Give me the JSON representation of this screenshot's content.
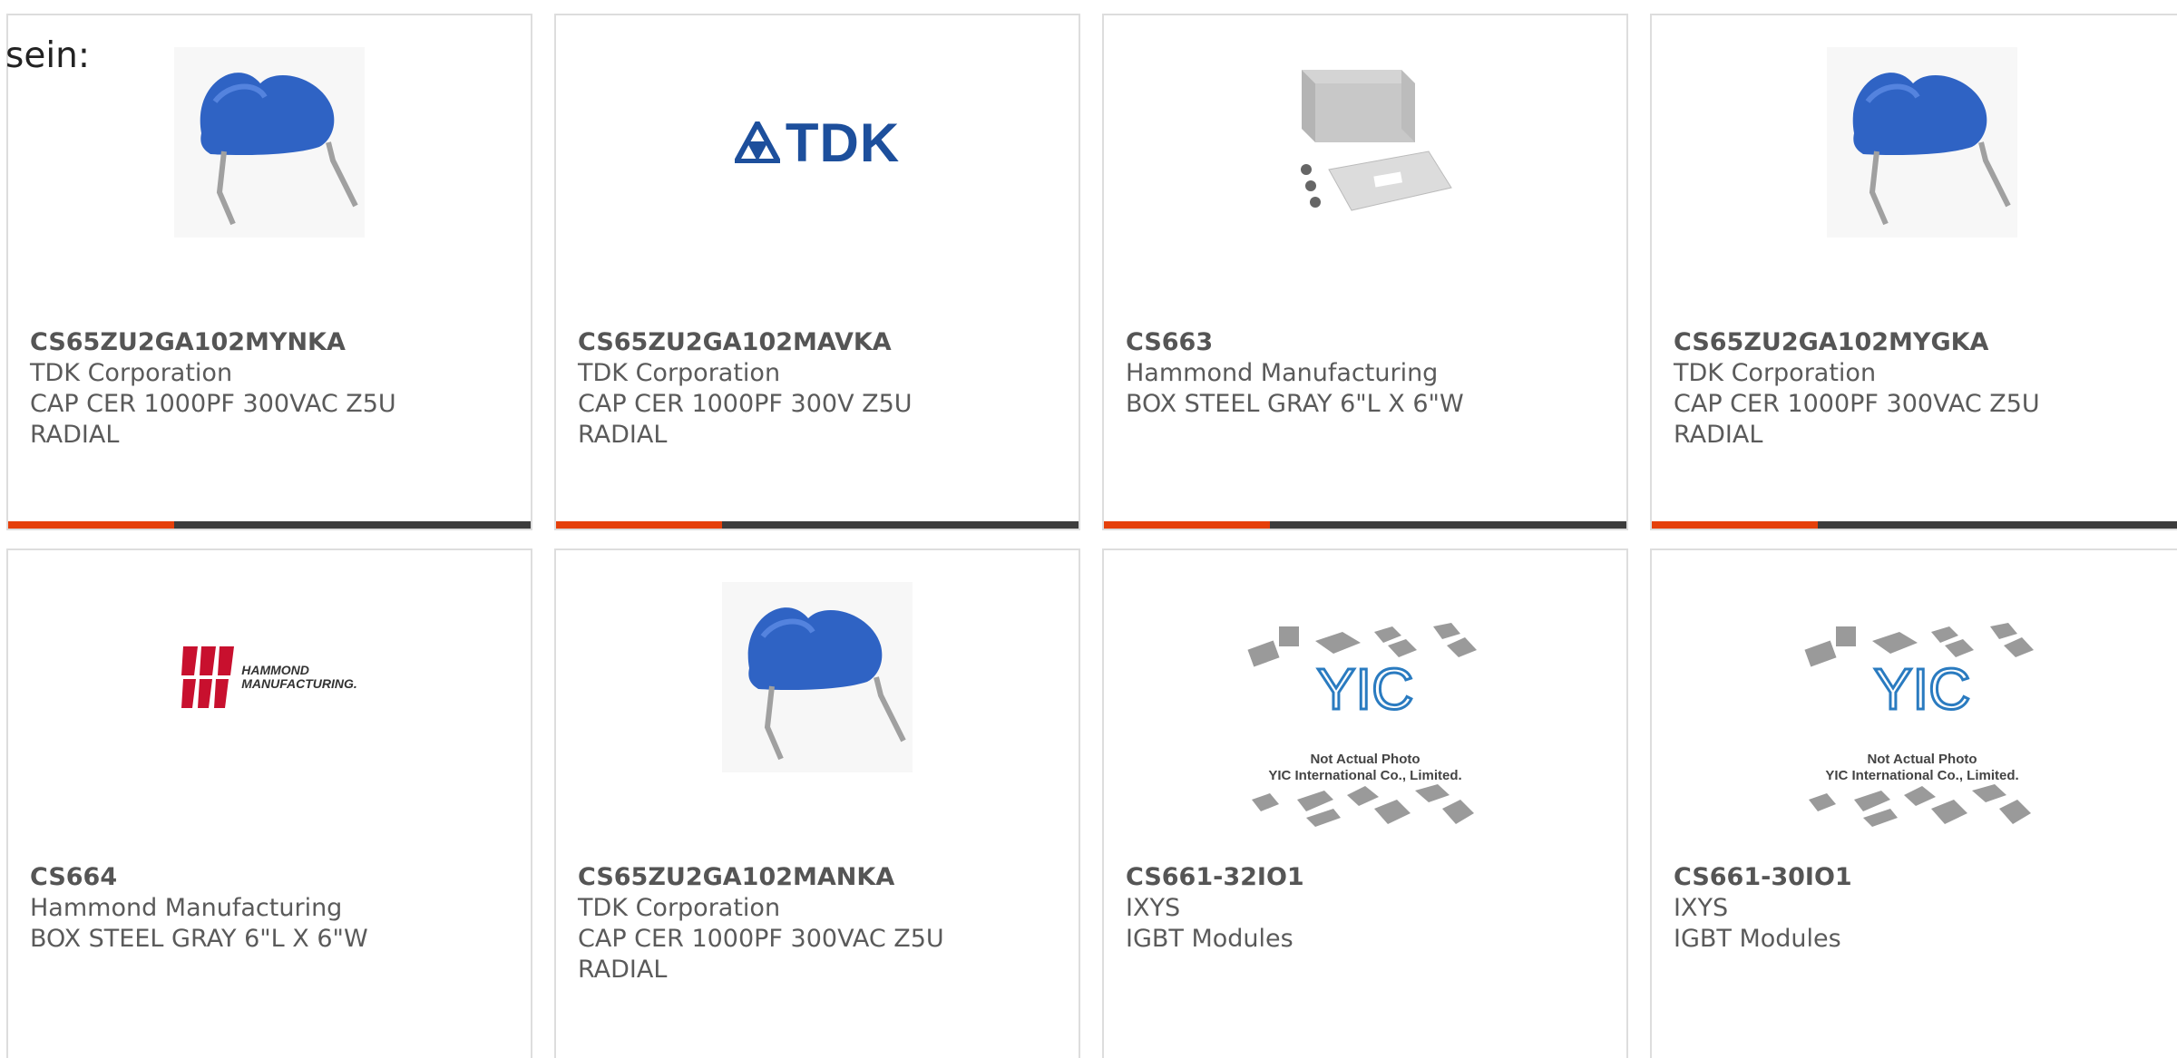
{
  "intro_text": "sein:",
  "accent_color": "#e5400b",
  "cards": [
    {
      "part_number": "CS65ZU2GA102MYNKA",
      "manufacturer": "TDK Corporation",
      "desc_line1": "CAP CER 1000PF 300VAC Z5U",
      "desc_line2": "RADIAL",
      "image": "blue-ceramic-capacitor-photo"
    },
    {
      "part_number": "CS65ZU2GA102MAVKA",
      "manufacturer": "TDK Corporation",
      "desc_line1": "CAP CER 1000PF 300V Z5U",
      "desc_line2": "RADIAL",
      "image": "tdk-logo",
      "logo_text": "TDK"
    },
    {
      "part_number": "CS663",
      "manufacturer": "Hammond Manufacturing",
      "desc_line1": "BOX STEEL GRAY 6\"L X 6\"W",
      "desc_line2": "",
      "image": "steel-box-photo"
    },
    {
      "part_number": "CS65ZU2GA102MYGKA",
      "manufacturer": "TDK Corporation",
      "desc_line1": "CAP CER 1000PF 300VAC Z5U",
      "desc_line2": "RADIAL",
      "image": "blue-ceramic-capacitor-photo"
    },
    {
      "part_number": "CS664",
      "manufacturer": "Hammond Manufacturing",
      "desc_line1": "BOX STEEL GRAY 6\"L X 6\"W",
      "desc_line2": "",
      "image": "hammond-logo",
      "logo_text_1": "HAMMOND",
      "logo_text_2": "MANUFACTURING."
    },
    {
      "part_number": "CS65ZU2GA102MANKA",
      "manufacturer": "TDK Corporation",
      "desc_line1": "CAP CER 1000PF 300VAC Z5U",
      "desc_line2": "RADIAL",
      "image": "blue-ceramic-capacitor-photo"
    },
    {
      "part_number": "CS661-32IO1",
      "manufacturer": "IXYS",
      "desc_line1": "IGBT Modules",
      "desc_line2": "",
      "image": "yic-placeholder",
      "placeholder_line1": "Not Actual Photo",
      "placeholder_line2": "YIC International Co., Limited."
    },
    {
      "part_number": "CS661-30IO1",
      "manufacturer": "IXYS",
      "desc_line1": "IGBT Modules",
      "desc_line2": "",
      "image": "yic-placeholder",
      "placeholder_line1": "Not Actual Photo",
      "placeholder_line2": "YIC International Co., Limited."
    }
  ]
}
